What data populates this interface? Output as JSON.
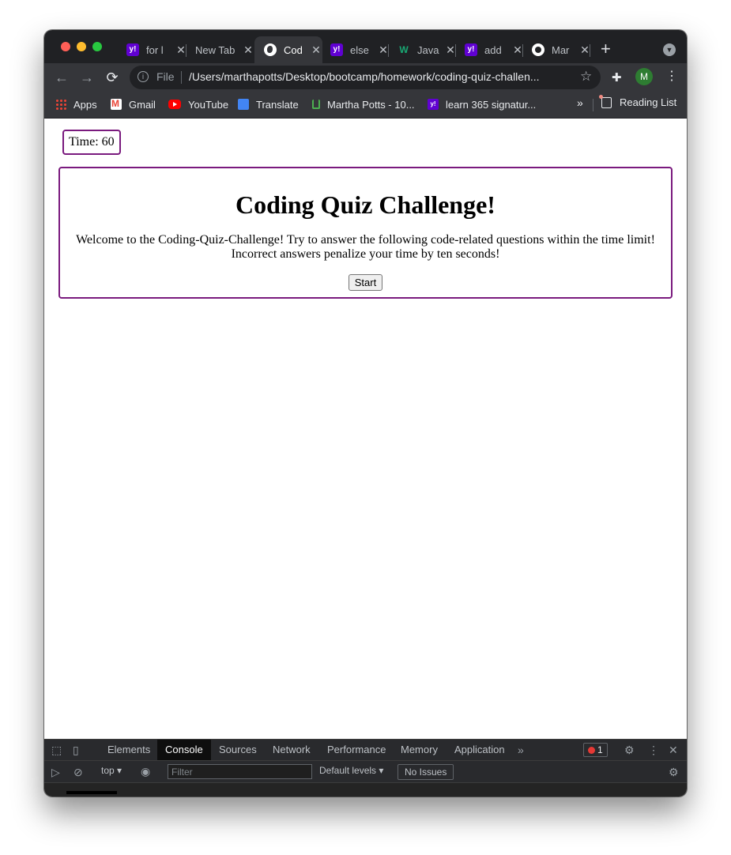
{
  "browser": {
    "tabs": [
      {
        "label": "for l",
        "icon": "yahoo-icon",
        "active": false
      },
      {
        "label": "New Tab",
        "icon": "",
        "active": false
      },
      {
        "label": "Cod",
        "icon": "globe-icon",
        "active": true
      },
      {
        "label": "else",
        "icon": "yahoo-icon",
        "active": false
      },
      {
        "label": "Java",
        "icon": "w3-icon",
        "active": false
      },
      {
        "label": "add",
        "icon": "yahoo-icon",
        "active": false
      },
      {
        "label": "Mar",
        "icon": "github-icon",
        "active": false
      }
    ],
    "new_tab_symbol": "+",
    "address": {
      "scheme_label": "File",
      "url": "/Users/marthapotts/Desktop/bootcamp/homework/coding-quiz-challen..."
    },
    "profile_initial": "M",
    "bookmarks": [
      {
        "label": "Apps",
        "icon": "apps-grid-icon"
      },
      {
        "label": "Gmail",
        "icon": "gmail-icon"
      },
      {
        "label": "YouTube",
        "icon": "youtube-icon"
      },
      {
        "label": "Translate",
        "icon": "translate-icon"
      },
      {
        "label": "Martha Potts - 10...",
        "icon": "udemy-icon"
      },
      {
        "label": "learn 365 signatur...",
        "icon": "yahoo-icon"
      }
    ],
    "bookmarks_more": "»",
    "reading_list": "Reading List"
  },
  "page": {
    "timer": "Time: 60",
    "title": "Coding Quiz Challenge!",
    "intro": "Welcome to the Coding-Quiz-Challenge! Try to answer the following code-related questions within the time limit! Incorrect answers penalize your time by ten seconds!",
    "start_label": "Start",
    "accent_color": "#7a1a7e"
  },
  "devtools": {
    "tabs": [
      "Elements",
      "Console",
      "Sources",
      "Network",
      "Performance",
      "Memory",
      "Application"
    ],
    "active_tab": "Console",
    "more": "»",
    "error_count": "1",
    "context": "top",
    "filter_placeholder": "Filter",
    "levels": "Default levels",
    "issues": "No Issues"
  }
}
